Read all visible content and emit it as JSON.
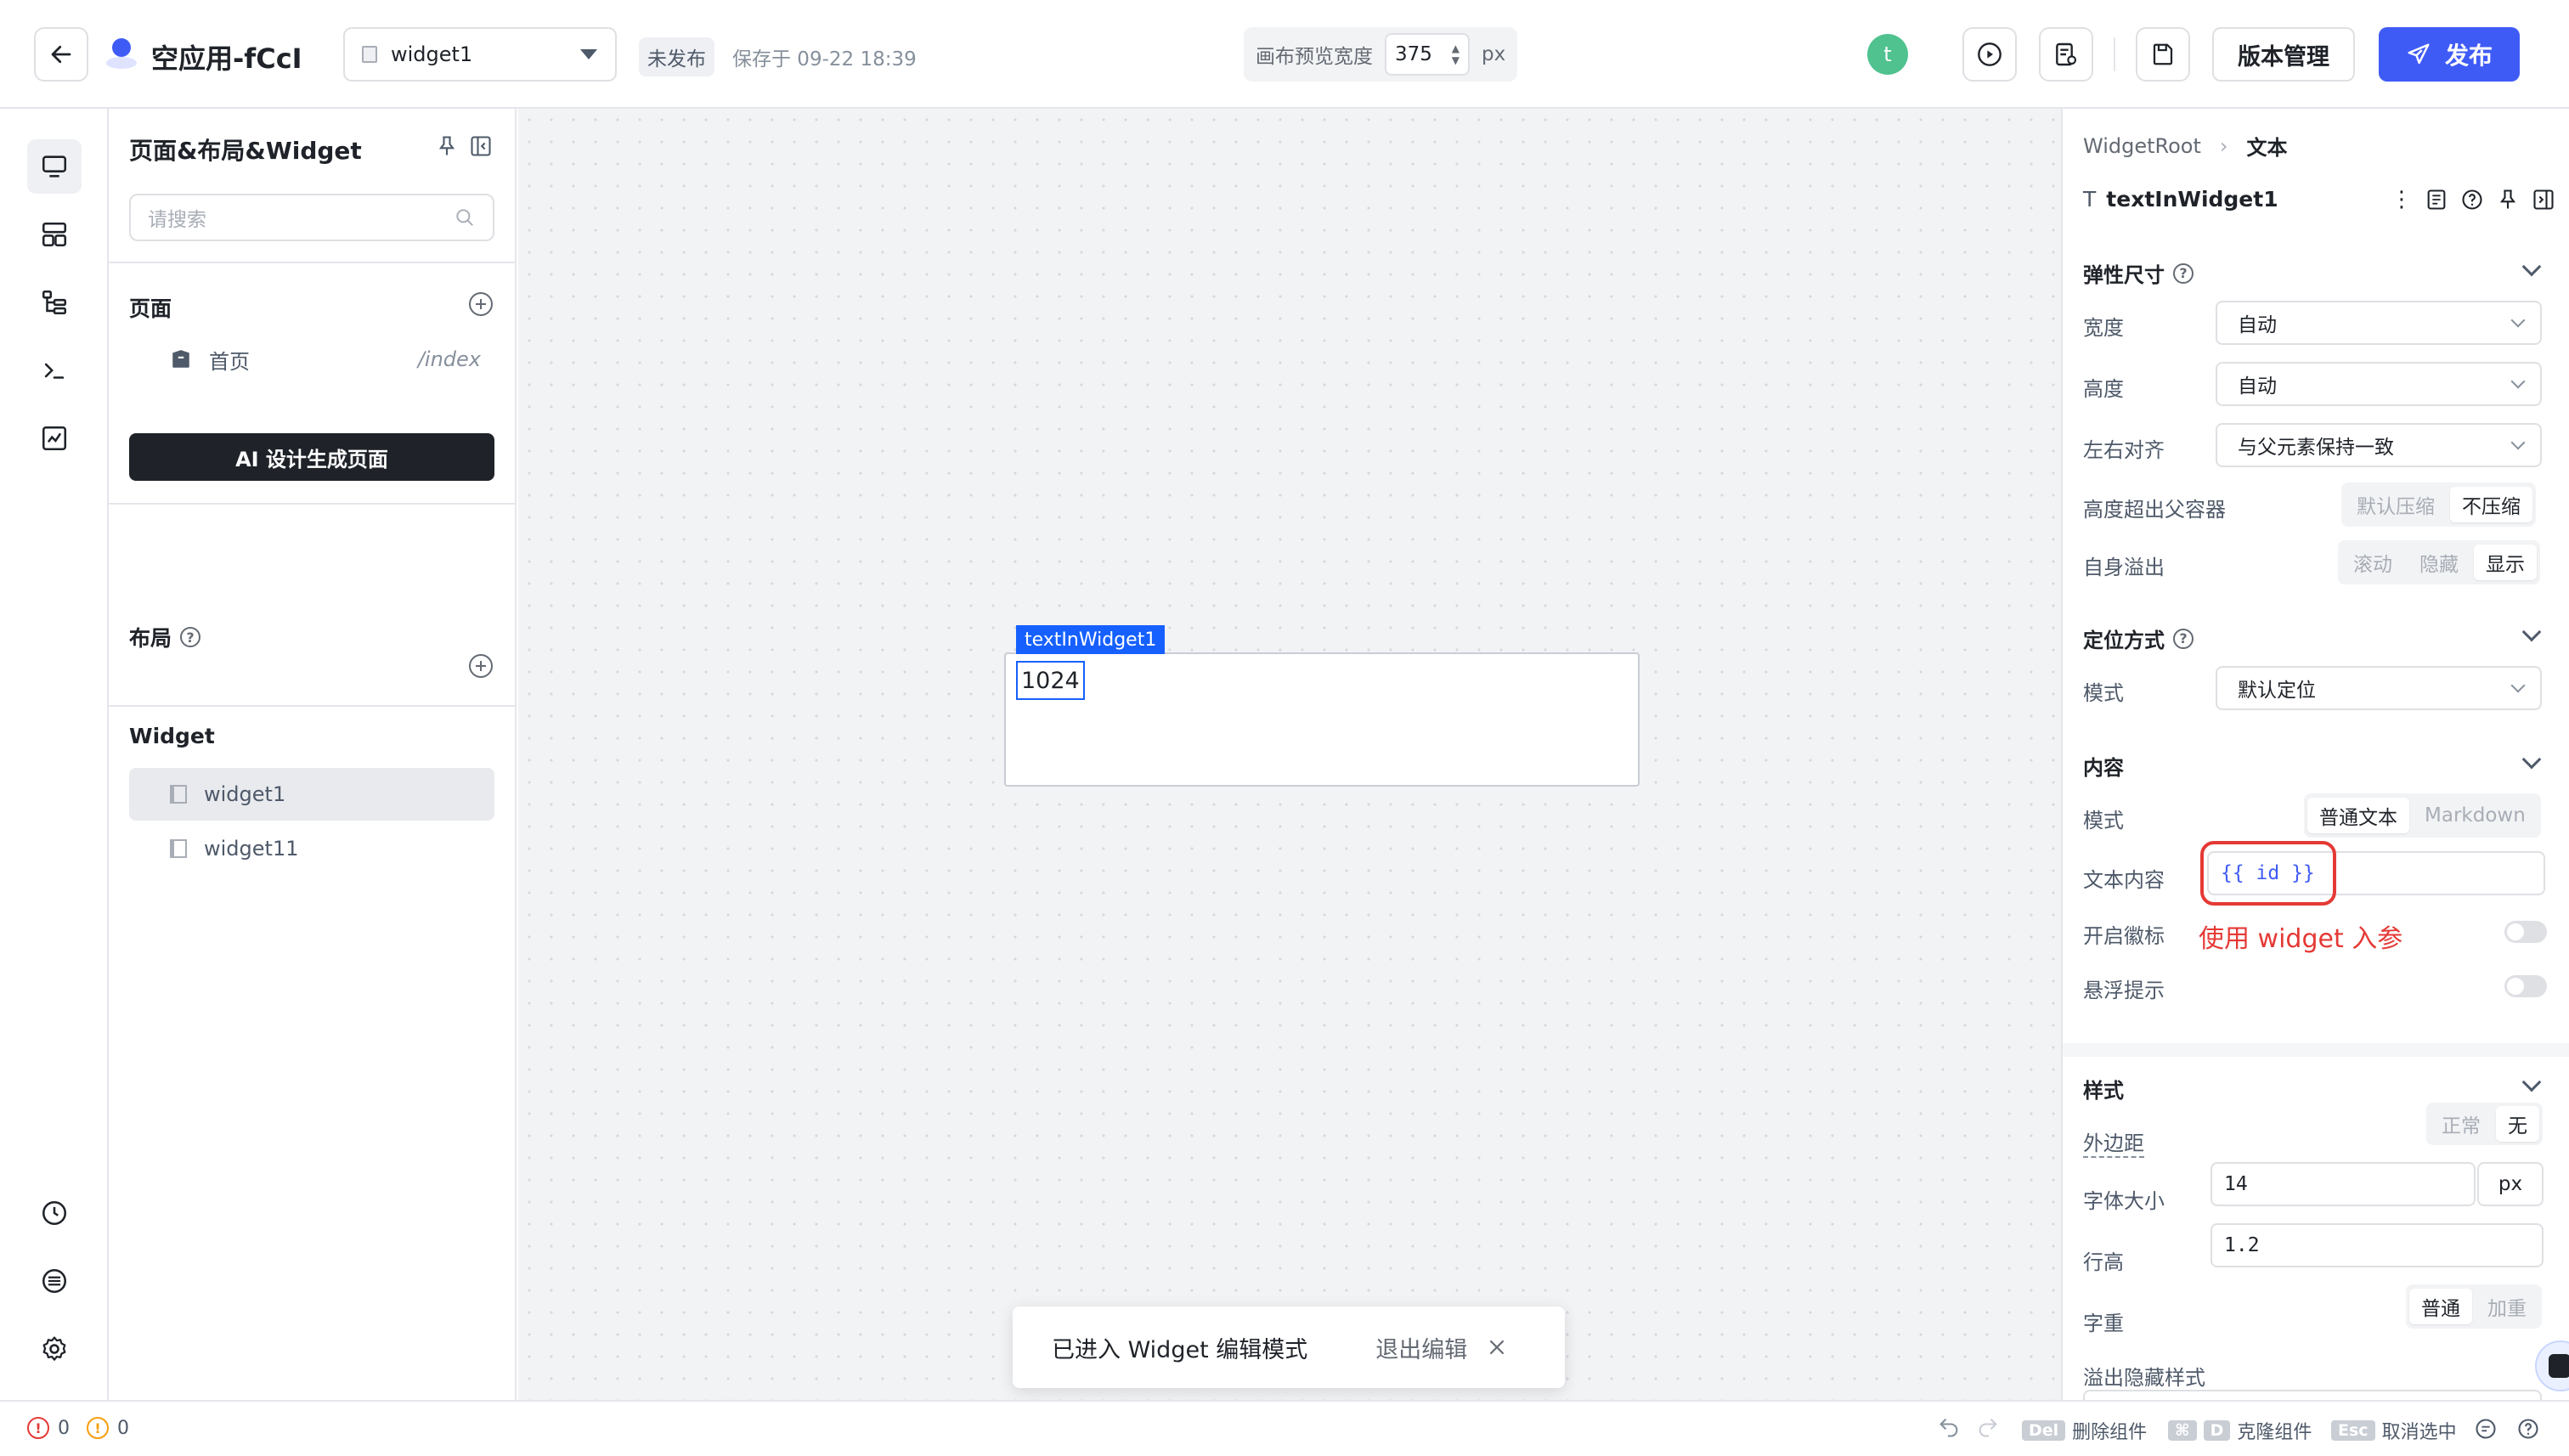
{
  "header": {
    "app_title": "空应用-fCcI",
    "widget_selector_value": "widget1",
    "publish_status": "未发布",
    "saved_text": "保存于 09-22 18:39",
    "canvas_width_label": "画布预览宽度",
    "canvas_width_value": "375",
    "canvas_width_unit": "px",
    "user_avatar_letter": "t",
    "version_button": "版本管理",
    "publish_button": "发布",
    "accent_color": "#3f5bf6"
  },
  "left_panel": {
    "title": "页面&布局&Widget",
    "search_placeholder": "请搜索",
    "pages_section": "页面",
    "pages": [
      {
        "name": "首页",
        "path": "/index"
      }
    ],
    "ai_button": "AI 设计生成页面",
    "layout_section": "布局",
    "widget_section": "Widget",
    "widgets": [
      {
        "name": "widget1",
        "selected": true
      },
      {
        "name": "widget11",
        "selected": false
      }
    ]
  },
  "canvas": {
    "selected_widget_tag": "textInWidget1",
    "text_value": "1024",
    "toast_message": "已进入 Widget 编辑模式",
    "toast_exit": "退出编辑"
  },
  "right_panel": {
    "breadcrumb_root": "WidgetRoot",
    "breadcrumb_current": "文本",
    "component_name": "textInWidget1",
    "flex_size": {
      "title": "弹性尺寸",
      "width_label": "宽度",
      "width_value": "自动",
      "height_label": "高度",
      "height_value": "自动",
      "align_label": "左右对齐",
      "align_value": "与父元素保持一致",
      "overflow_parent_label": "高度超出父容器",
      "overflow_parent_options": [
        "默认压缩",
        "不压缩"
      ],
      "self_overflow_label": "自身溢出",
      "self_overflow_options": [
        "滚动",
        "隐藏",
        "显示"
      ]
    },
    "position": {
      "title": "定位方式",
      "mode_label": "模式",
      "mode_value": "默认定位"
    },
    "content": {
      "title": "内容",
      "mode_label": "模式",
      "mode_options": [
        "普通文本",
        "Markdown"
      ],
      "text_label": "文本内容",
      "text_value": "{{ id }}",
      "annotation": "使用 widget 入参",
      "badge_label": "开启徽标",
      "tooltip_label": "悬浮提示"
    },
    "style": {
      "title": "样式",
      "margin_label": "外边距",
      "margin_options": [
        "正常",
        "无"
      ],
      "font_size_label": "字体大小",
      "font_size_value": "14",
      "font_size_unit": "px",
      "line_height_label": "行高",
      "line_height_value": "1.2",
      "weight_label": "字重",
      "weight_options": [
        "普通",
        "加重"
      ],
      "overflow_style_label": "溢出隐藏样式"
    }
  },
  "footer": {
    "error_count": "0",
    "warning_count": "0",
    "shortcuts": [
      {
        "key": "Del",
        "label": "删除组件"
      },
      {
        "key": "D",
        "label": "克隆组件"
      },
      {
        "key": "Esc",
        "label": "取消选中"
      }
    ]
  }
}
